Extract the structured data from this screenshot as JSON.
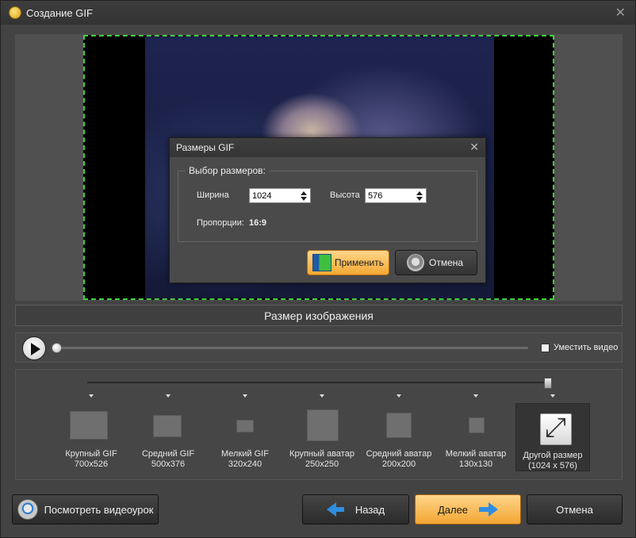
{
  "window": {
    "title": "Создание GIF",
    "close_glyph": "✕"
  },
  "dialog": {
    "title": "Размеры GIF",
    "close_glyph": "✕",
    "group_label": "Выбор размеров:",
    "width_label": "Ширина",
    "width_value": "1024",
    "height_label": "Высота",
    "height_value": "576",
    "ratio_label": "Пропорции:",
    "ratio_value": "16:9",
    "apply_label": "Применить",
    "cancel_label": "Отмена"
  },
  "section_title": "Размер изображения",
  "player": {
    "fit_label": "Уместить видео",
    "fit_checked": false
  },
  "presets": [
    {
      "name": "Крупный GIF",
      "size": "700x526"
    },
    {
      "name": "Средний GIF",
      "size": "500x376"
    },
    {
      "name": "Мелкий GIF",
      "size": "320x240"
    },
    {
      "name": "Крупный аватар",
      "size": "250x250"
    },
    {
      "name": "Средний аватар",
      "size": "200x200"
    },
    {
      "name": "Мелкий аватар",
      "size": "130x130"
    },
    {
      "name": "Другой размер",
      "size": "(1024 x 576)",
      "selected": true
    }
  ],
  "buttons": {
    "tutorial": "Посмотреть видеоурок",
    "back": "Назад",
    "next": "Далее",
    "cancel": "Отмена"
  },
  "colors": {
    "accent_orange": "#f4a934",
    "selection_dash": "#3ecf3e",
    "arrow_blue": "#2f8ee0"
  }
}
